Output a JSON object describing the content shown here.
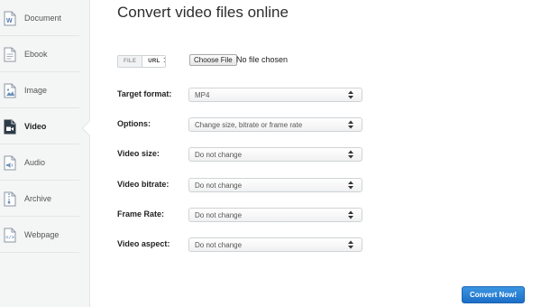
{
  "sidebar": {
    "items": [
      {
        "label": "Document",
        "icon": "document-icon"
      },
      {
        "label": "Ebook",
        "icon": "ebook-icon"
      },
      {
        "label": "Image",
        "icon": "image-icon"
      },
      {
        "label": "Video",
        "icon": "video-icon",
        "active": true
      },
      {
        "label": "Audio",
        "icon": "audio-icon"
      },
      {
        "label": "Archive",
        "icon": "archive-icon"
      },
      {
        "label": "Webpage",
        "icon": "webpage-icon"
      }
    ]
  },
  "main": {
    "title": "Convert video files online",
    "source_toggle": {
      "options": [
        "FILE",
        "URL"
      ],
      "selected": "URL",
      "suffix": ":"
    },
    "file_input": {
      "button_label": "Choose File",
      "status": "No file chosen"
    },
    "fields": [
      {
        "label": "Target format:",
        "value": "MP4"
      },
      {
        "label": "Options:",
        "value": "Change size, bitrate or frame rate"
      },
      {
        "label": "Video size:",
        "value": "Do not change"
      },
      {
        "label": "Video bitrate:",
        "value": "Do not change"
      },
      {
        "label": "Frame Rate:",
        "value": "Do not change"
      },
      {
        "label": "Video aspect:",
        "value": "Do not change"
      }
    ],
    "convert_label": "Convert Now!"
  },
  "colors": {
    "accent": "#2a80d8",
    "sidebar_bg": "#f4f5f5",
    "icon_blue": "#6b8fb8",
    "icon_active": "#2d3a48"
  }
}
